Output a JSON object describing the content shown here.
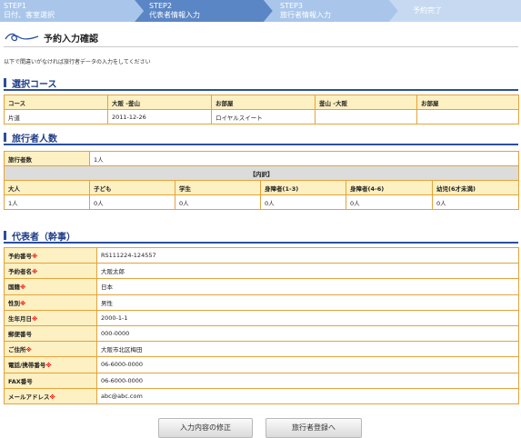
{
  "steps": [
    {
      "l1": "STEP1",
      "l2": "日付、客室選択"
    },
    {
      "l1": "STEP2",
      "l2": "代表者情報入力"
    },
    {
      "l1": "STEP3",
      "l2": "旅行者情報入力"
    },
    {
      "l1": "",
      "l2": "予約完了"
    }
  ],
  "page_title": "予約入力確認",
  "intro": "以下で間違いがなければ旅行者データの入力をしてください",
  "course": {
    "title": "選択コース",
    "headers": [
      "コース",
      "大阪 ‐釜山",
      "お部屋",
      "釜山 ‐大阪",
      "お部屋"
    ],
    "values": [
      "片道",
      "2011-12-26",
      "ロイヤルスイート",
      "",
      ""
    ]
  },
  "travelers": {
    "title": "旅行者人数",
    "count_label": "旅行者数",
    "count_value": "1人",
    "breakdown_label": "【内訳】",
    "headers": [
      "大人",
      "子ども",
      "学生",
      "身障者(1-3)",
      "身障者(4-6)",
      "幼児(6才未満)"
    ],
    "values": [
      "1人",
      "0人",
      "0人",
      "0人",
      "0人",
      "0人"
    ]
  },
  "representative": {
    "title": "代表者（幹事）",
    "required_mark": "※",
    "rows": [
      {
        "label": "予約番号",
        "req": true,
        "value": "RS111224-124557"
      },
      {
        "label": "予約者名",
        "req": true,
        "value": "大阪太郎"
      },
      {
        "label": "国籍",
        "req": true,
        "value": "日本"
      },
      {
        "label": "性別",
        "req": true,
        "value": "男性"
      },
      {
        "label": "生年月日",
        "req": true,
        "value": "2000-1-1"
      },
      {
        "label": "郵便番号",
        "req": false,
        "value": "000-0000"
      },
      {
        "label": "ご住所",
        "req": true,
        "value": "大阪市北区梅田"
      },
      {
        "label": "電話/携帯番号",
        "req": true,
        "value": "06-6000-0000"
      },
      {
        "label": "FAX番号",
        "req": false,
        "value": "06-6000-0000"
      },
      {
        "label": "メールアドレス",
        "req": true,
        "value": "abc@abc.com"
      }
    ]
  },
  "buttons": {
    "modify": "入力内容の修正",
    "next": "旅行者登録へ"
  },
  "colors": {
    "step_active": "#5b86c5",
    "step_inactive": "#a9c6ea",
    "heading": "#2b4f9e",
    "border": "#e3a33c",
    "label_bg": "#fdf0c2",
    "required": "#e00000"
  }
}
